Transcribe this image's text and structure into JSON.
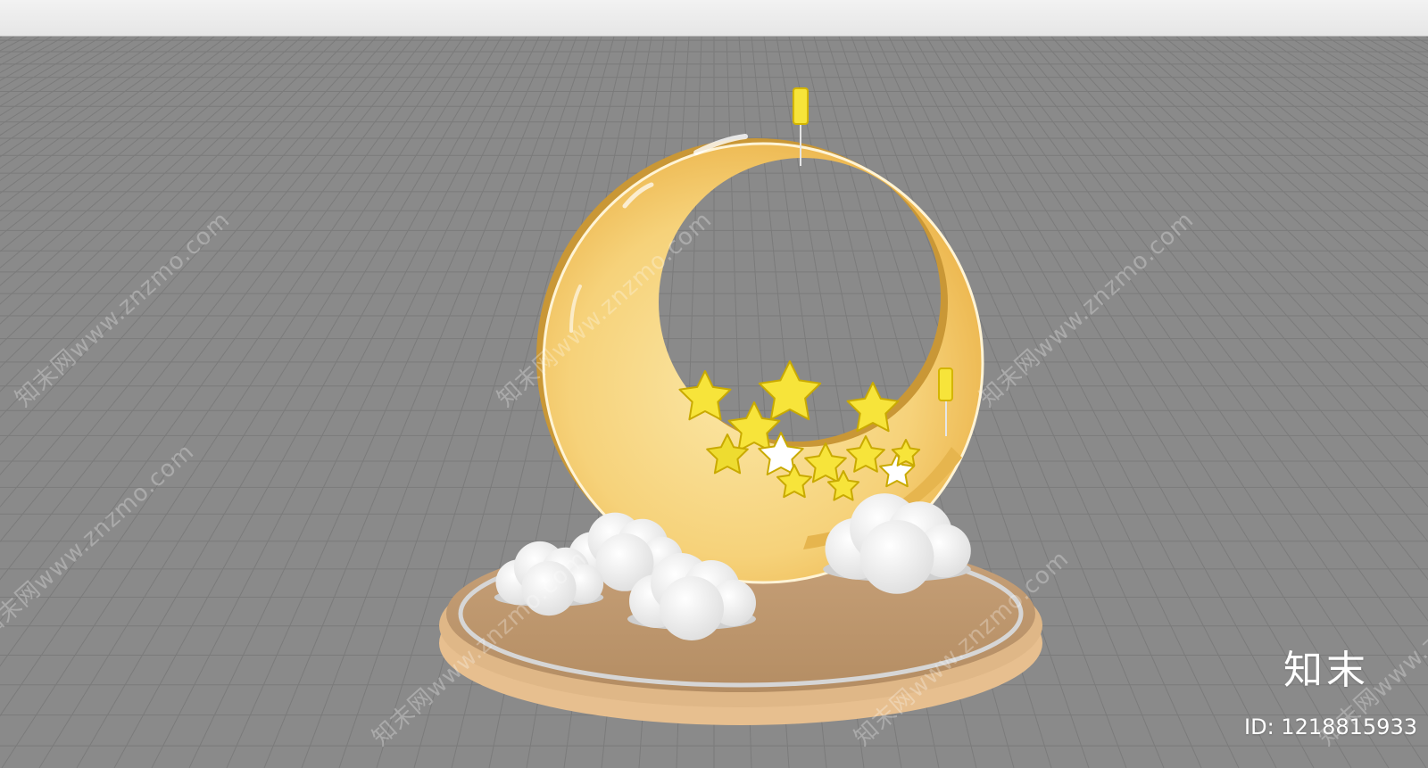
{
  "watermark": {
    "text": "知末网www.znzmo.com"
  },
  "brand": {
    "name": "知末",
    "id_prefix": "ID: ",
    "id_value": "1218815933"
  },
  "colors": {
    "viewport_bg": "#8a8a8a",
    "grid_line": "#7a7a7a",
    "moon_fill": "#f5cf6a",
    "star_fill": "#f7e43a",
    "cloud_fill": "#f4f4f4",
    "base_top": "#c9a47a",
    "base_rim": "#e9c49a",
    "base_ring": "#d8d8d8"
  }
}
